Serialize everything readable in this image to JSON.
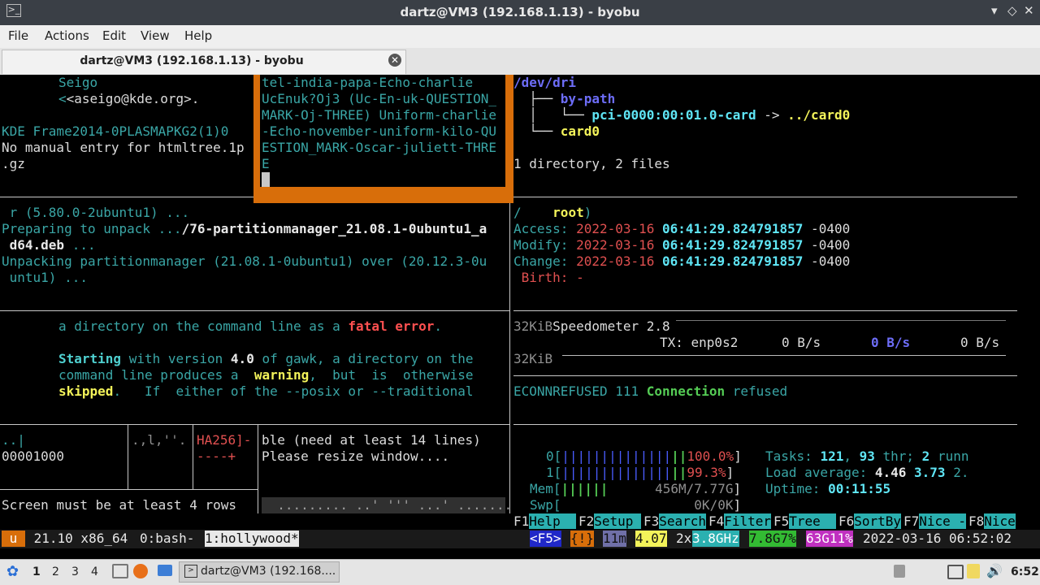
{
  "window": {
    "title": "dartz@VM3 (192.168.1.13) - byobu"
  },
  "menu": {
    "file": "File",
    "actions": "Actions",
    "edit": "Edit",
    "view": "View",
    "help": "Help"
  },
  "tab": {
    "label": "dartz@VM3 (192.168.1.13) - byobu"
  },
  "pane1": {
    "l1": "Seigo",
    "l2": "<aseigo@kde.org>.",
    "l3": "KDE Frame2014-0PLASMAPKG2(1)0",
    "l4": "No manual entry for htmltree.1p",
    "l5": ".gz"
  },
  "popup": {
    "l1": "tel-india-papa-Echo-charlie",
    "l2": "UcEnuk?Oj3 (Uc-En-uk-QUESTION_",
    "l3": "MARK-Oj-THREE) Uniform-charlie",
    "l4": "-Echo-november-uniform-kilo-QU",
    "l5": "ESTION_MARK-Oscar-juliett-THRE",
    "l6": "E"
  },
  "tree": {
    "root": "/dev/dri",
    "bypath": "by-path",
    "pci": "pci-0000:00:01.0-card",
    "arrow": " -> ",
    "card0link": "../card0",
    "card0": "card0",
    "summary": "1 directory, 2 files"
  },
  "apt": {
    "l1": " r (5.80.0-2ubuntu1) ...",
    "l2a": "Preparing to unpack ...",
    "l2b": "/76-partitionmanager_21.08.1-0ubuntu1_a",
    "l3": " d64.deb",
    "l3b": " ...",
    "l4": "Unpacking partitionmanager (21.08.1-0ubuntu1) over (20.12.3-0u",
    "l5": " untu1) ..."
  },
  "stat": {
    "slash": "/",
    "owner": "root",
    "close": ")",
    "access_lbl": "Access: ",
    "modify_lbl": "Modify: ",
    "change_lbl": "Change: ",
    "date": "2022-03-16 ",
    "time": "06:41:29.824791857",
    "tz": " -0400",
    "birth": " Birth: -"
  },
  "gawk": {
    "l1a": "a directory on the command line as a ",
    "fatal": "fatal",
    "error": "error",
    "l1c": ".",
    "starting": "Starting",
    "l2b": " with version ",
    "ver": "4.0",
    "l2c": " of gawk, a directory on the",
    "l3a": "command line produces a  ",
    "warning": "warning",
    "l3b": ",  but  is  otherwise",
    "skipped": "skipped",
    "l4b": ".   If  either of the --posix or --traditional"
  },
  "speed": {
    "k1": "32KiB",
    "title": "Speedometer 2.8",
    "tx": "TX: enp0s2",
    "v1": "0 B/s",
    "v2": "0 B/s",
    "v3": "0 B/s",
    "k2": "32KiB"
  },
  "conn": {
    "code": "ECONNREFUSED 111 ",
    "word": "Connection",
    "rest": " refused"
  },
  "hex": {
    "a1": "..|",
    "a2": "00001000",
    "b1": ".,l,''.",
    "c1": "HA256]-",
    "c2": "----+"
  },
  "resize": {
    "l1": "ble (need at least 14 lines)",
    "l2": "Please resize window...."
  },
  "small": {
    "l1": "Screen must be at least 4 rows",
    "dots": "  ......... ..' ''' ...' ......."
  },
  "htop": {
    "cpu0_lbl": "0[",
    "cpu0_bars": "||||||||||||||",
    "cpu0_pct": "100.0%",
    "cpu1_lbl": "1[",
    "cpu1_bars": "||||||||||||||",
    "cpu1_pct": "99.3%",
    "mem_lbl": "Mem[",
    "mem_bars": "||||||",
    "mem_val": "456M/7.77G",
    "swp_lbl": "Swp[",
    "swp_val": "0K/0K",
    "tasks_lbl": "Tasks: ",
    "tasks": "121",
    "sep": ", ",
    "thr": "93",
    "thr_lbl": " thr; ",
    "run": "2",
    "run_lbl": " runn",
    "load_lbl": "Load average: ",
    "l1": "4.46",
    "l2": "3.73",
    "l3": "2.",
    "up_lbl": "Uptime: ",
    "up": "00:11:55",
    "close": "]"
  },
  "fkeys": [
    {
      "k": "F1",
      "l": "Help  "
    },
    {
      "k": "F2",
      "l": "Setup "
    },
    {
      "k": "F3",
      "l": "Search"
    },
    {
      "k": "F4",
      "l": "Filter"
    },
    {
      "k": "F5",
      "l": "Tree  "
    },
    {
      "k": "F6",
      "l": "SortBy"
    },
    {
      "k": "F7",
      "l": "Nice -"
    },
    {
      "k": "F8",
      "l": "Nice"
    }
  ],
  "statusbar": {
    "u": " u ",
    "os": " 21.10 x86_64 ",
    "w0": "0:bash- ",
    "w1": "1:hollywood*",
    "f5": "<F5>",
    "bang": "{!}",
    "up": "11m",
    "load": "4.07",
    "cpus": "2x",
    "ghz": "3.8GHz",
    "mem": "7.8G7%",
    "disk": "63G11%",
    "dt": "2022-03-16 06:52:02"
  },
  "taskbar": {
    "d1": "1",
    "d2": "2",
    "d3": "3",
    "d4": "4",
    "task": "dartz@VM3 (192.168....",
    "clock": "6:52"
  },
  "colors": {
    "accent_orange": "#d86e0a",
    "cyan": "#3aa6a6",
    "htop_label": "#2bb0b0"
  }
}
